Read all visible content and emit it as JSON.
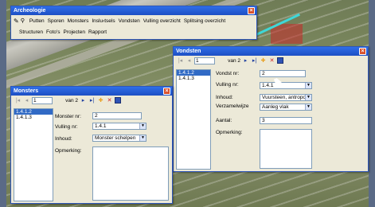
{
  "app": {
    "title": "Archeologie",
    "menu": [
      "Putten",
      "Sporen",
      "Monsters",
      "Inslu‹tsels",
      "Vondsten",
      "Vulling overzicht",
      "Splitsing overzicht"
    ],
    "menu2": [
      "Structuren",
      "Foto's",
      "Projecten",
      "Rapport"
    ]
  },
  "vondsten": {
    "title": "Vondsten",
    "nav": {
      "record": "1",
      "of_label": "van 2"
    },
    "list": [
      "1.4.1.2",
      "1.4.1.3"
    ],
    "labels": {
      "vondst_nr": "Vondst nr:",
      "vulling_nr": "Vulling nr:",
      "inhoud": "Inhoud:",
      "verzamelwijze": "Verzamelwijze",
      "aantal": "Aantal:",
      "opmerking": "Opmerking:"
    },
    "values": {
      "vondst_nr": "2",
      "vulling_nr": "1.4.1",
      "inhoud": "Vuursteen, antropog",
      "verzamelwijze": "Aanleg vlak",
      "aantal": "3"
    }
  },
  "monsters": {
    "title": "Monsters",
    "nav": {
      "record": "1",
      "of_label": "van 2"
    },
    "list": [
      "1.4.1.2",
      "1.4.1.3"
    ],
    "labels": {
      "monster_nr": "Monster nr:",
      "vulling_nr": "Vulling nr:",
      "inhoud": "Inhoud:",
      "opmerking": "Opmerking:"
    },
    "values": {
      "monster_nr": "2",
      "vulling_nr": "1.4.1",
      "inhoud": "Monster schelpen"
    }
  },
  "icons": {
    "first": "first-record-icon",
    "prev": "previous-record-icon",
    "next": "next-record-icon",
    "last": "last-record-icon",
    "add": "add-record-icon",
    "delete": "delete-record-icon",
    "save": "save-icon"
  },
  "colors": {
    "titlebar": "#1d4fc4",
    "selection": "#316ac5",
    "window": "#ece9d8"
  }
}
